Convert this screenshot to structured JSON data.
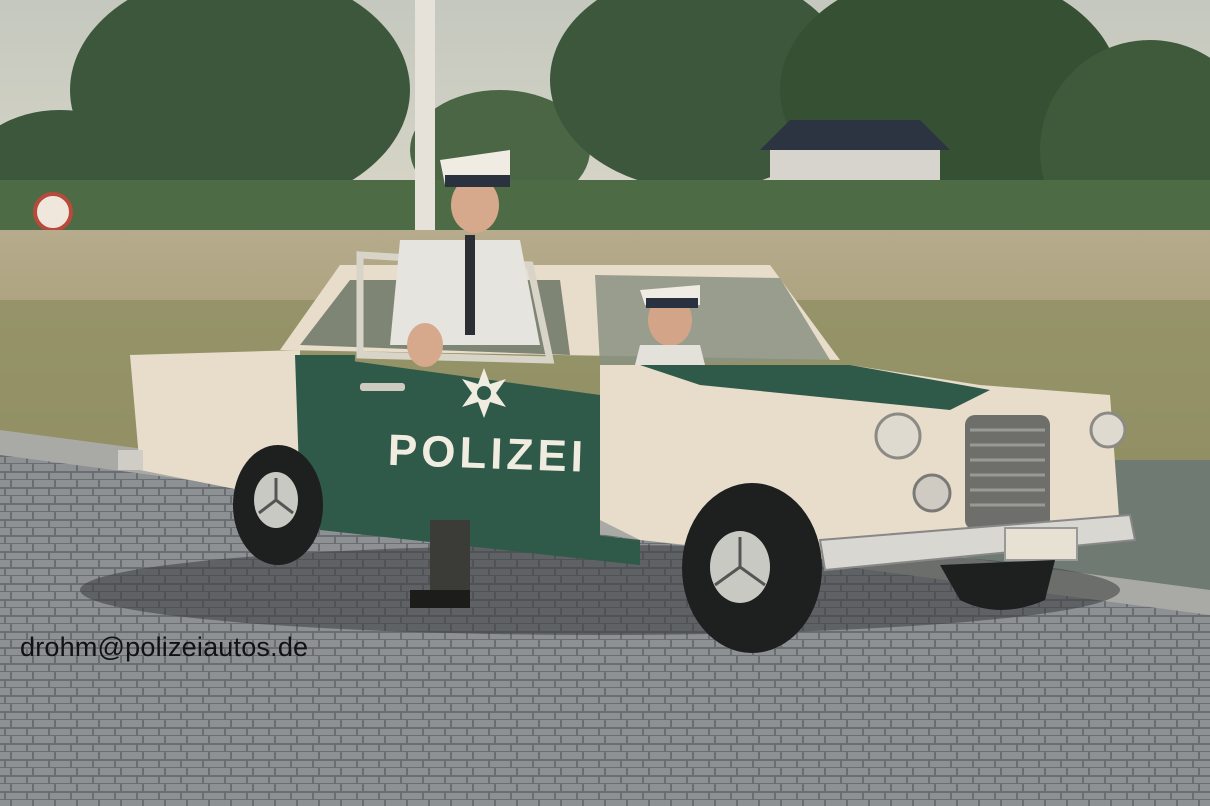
{
  "photo": {
    "door_lettering": "POLIZEI",
    "watermark": "drohm@polizeiautos.de"
  },
  "colors": {
    "car_cream": "#e8dccb",
    "police_green": "#2f5a4a",
    "sky": "#c9cdc0",
    "foliage": "#3f5a3d",
    "cobblestone": "#8b8f92",
    "grass": "#8d8e62",
    "watermark": "#111111"
  },
  "icons": [
    "police-star-icon",
    "mercedes-star-icon",
    "traffic-sign-icon"
  ]
}
